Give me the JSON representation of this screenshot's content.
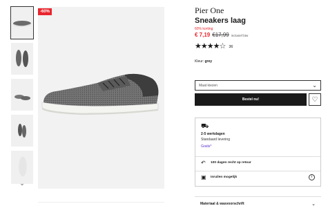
{
  "gallery": {
    "discount_badge": "-60%",
    "thumbnail_count": 5
  },
  "product": {
    "brand": "Pier One",
    "name": "Sneakers laag",
    "discount_label": "60% korting",
    "price_now": "€ 7,19",
    "price_old": "€17,99",
    "price_note": "inclusief btw",
    "rating_stars_filled": 4,
    "rating_stars_total": 5,
    "rating_count": "36",
    "color_label": "Kleur:",
    "color_value": "grey"
  },
  "purchase": {
    "size_placeholder": "Maat kiezen",
    "buy_label": "Bestel nu!"
  },
  "delivery": {
    "days": "2-5 werkdagen",
    "method": "Standaard levering",
    "cost": "Gratis*",
    "returns": "100 dagen recht op retour",
    "exchange": "Inruilen mogelijk"
  },
  "details": {
    "material_label": "Materiaal & wasvoorschrift"
  }
}
